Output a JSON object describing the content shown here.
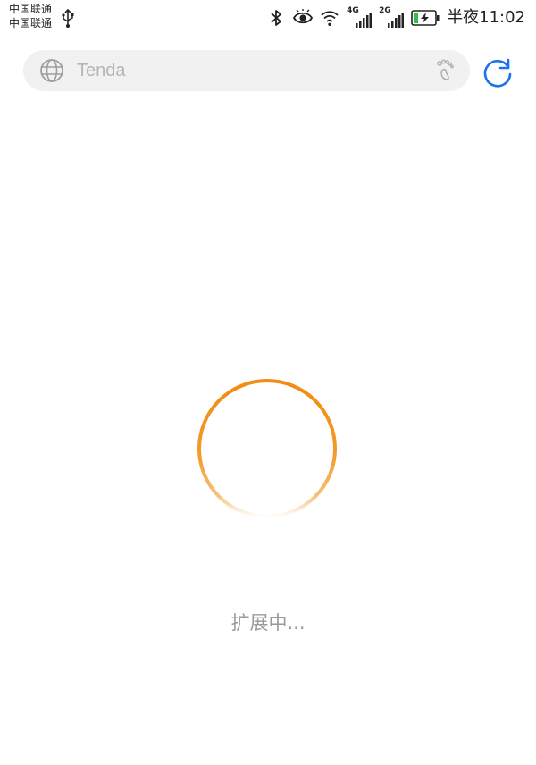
{
  "status_bar": {
    "carrier_1": "中国联通",
    "carrier_2": "中国联通",
    "time": "半夜11:02",
    "signal_1_label": "4G",
    "signal_2_label": "2G",
    "icons": [
      "usb-icon",
      "bluetooth-icon",
      "eye-icon",
      "wifi-icon",
      "signal-4g-icon",
      "signal-2g-icon",
      "battery-charging-icon"
    ]
  },
  "address_bar": {
    "value": "Tenda",
    "icons": [
      "globe-icon",
      "footprint-icon",
      "refresh-icon"
    ]
  },
  "loading": {
    "text": "扩展中...",
    "spinner_color": "#f28c13"
  },
  "colors": {
    "accent_blue": "#1a73e8",
    "address_bg": "#f1f1f1",
    "placeholder_gray": "#b5b5b5",
    "loading_text_gray": "#9a9a9a"
  }
}
